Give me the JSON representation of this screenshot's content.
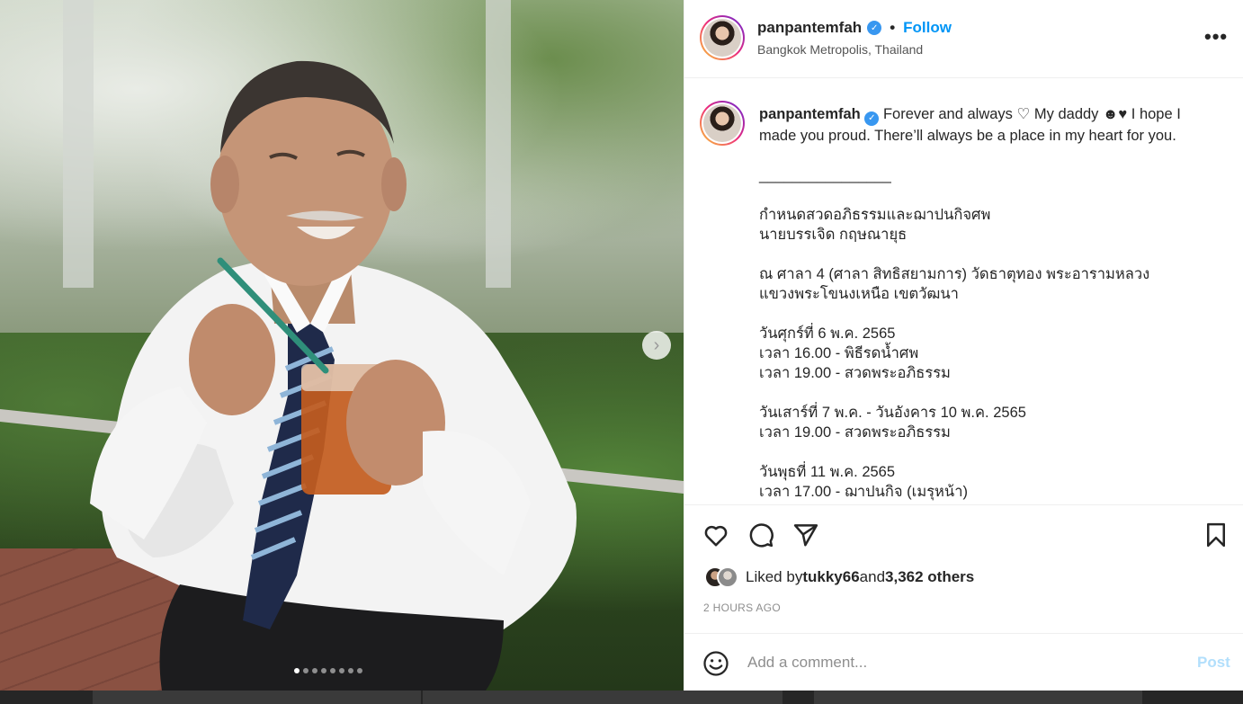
{
  "post": {
    "username": "panpantemfah",
    "follow_label": "Follow",
    "separator": "•",
    "location": "Bangkok Metropolis, Thailand",
    "more_label": "•••"
  },
  "caption": {
    "username": "panpantemfah",
    "first_line_a": " Forever and always ",
    "first_line_b": " My daddy ",
    "first_line_c": "♥ I hope I",
    "second_line": "made you proud. There’ll always be a place in my heart for you.",
    "rule": "________________",
    "block1": [
      "กำหนดสวดอภิธรรมและฌาปนกิจศพ",
      "นายบรรเจิด กฤษณายุธ"
    ],
    "block2": [
      "ณ ศาลา 4 (ศาลา สิทธิสยามการ) วัดธาตุทอง พระอารามหลวง",
      "แขวงพระโขนงเหนือ เขตวัฒนา"
    ],
    "block3": [
      "วันศุกร์ที่ 6 พ.ค. 2565",
      "เวลา 16.00 - พิธีรดน้ำศพ",
      "เวลา 19.00 - สวดพระอภิธรรม"
    ],
    "block4": [
      "วันเสาร์ที่ 7 พ.ค. - วันอังคาร 10 พ.ค. 2565",
      "เวลา 19.00 - สวดพระอภิธรรม"
    ],
    "block5": [
      "วันพุธที่ 11 พ.ค. 2565",
      "เวลา 17.00 - ฌาปนกิจ (เมรุหน้า)"
    ]
  },
  "likes": {
    "prefix": "Liked by ",
    "user": "tukky66",
    "middle": " and ",
    "others": "3,362 others"
  },
  "timestamp": "2 HOURS AGO",
  "comment": {
    "placeholder": "Add a comment...",
    "post_label": "Post"
  },
  "carousel": {
    "total": 8,
    "active_index": 0,
    "next_icon": "chevron-right-icon"
  },
  "colors": {
    "accent": "#0095f6",
    "post_disabled": "#b2dffc",
    "verified": "#3897f0"
  }
}
